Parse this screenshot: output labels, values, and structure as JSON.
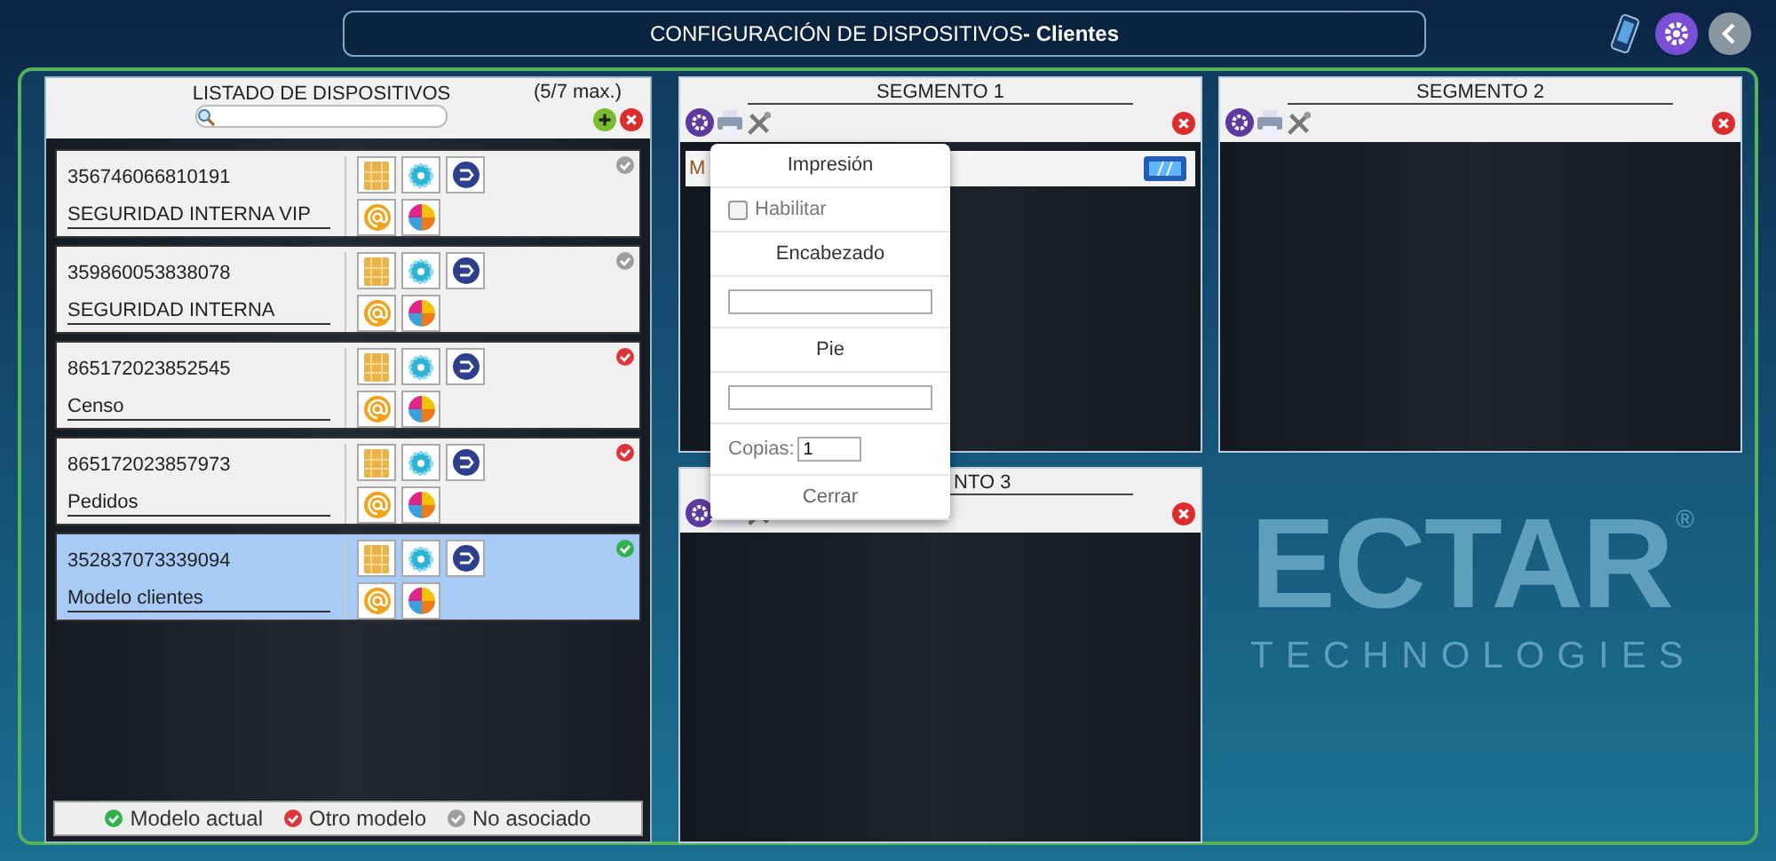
{
  "header": {
    "title": "CONFIGURACIÓN DE DISPOSITIVOS**- Clientes**"
  },
  "device_list": {
    "title": "LISTADO DE DISPOSITIVOS",
    "count": "(5/7 max.)",
    "devices": [
      {
        "number": "356746066810191",
        "name": "SEGURIDAD INTERNA VIP",
        "color": "#9e9e9e",
        "selected": false
      },
      {
        "number": "359860053838078",
        "name": "SEGURIDAD INTERNA",
        "color": "#9e9e9e",
        "selected": false
      },
      {
        "number": "865172023852545",
        "name": "Censo",
        "color": "#e0343c",
        "selected": false
      },
      {
        "number": "865172023857973",
        "name": "Pedidos",
        "color": "#e0343c",
        "selected": false
      },
      {
        "number": "352837073339094",
        "name": "Modelo clientes",
        "color": "#2fb34a",
        "selected": true
      }
    ],
    "legend": [
      {
        "label": "Modelo actual",
        "color": "#2fb34a"
      },
      {
        "label": "Otro modelo",
        "color": "#e0343c"
      },
      {
        "label": "No asociado",
        "color": "#9e9e9e"
      }
    ]
  },
  "segments": [
    {
      "title": "SEGMENTO 1",
      "partially_hidden": false,
      "rows": [
        {
          "label": "M"
        }
      ]
    },
    {
      "title": "SEGMENTO 2",
      "partially_hidden": false
    },
    {
      "title": "NTO 3",
      "partially_hidden": true
    }
  ],
  "print_popup": {
    "title": "Impresión",
    "enable": {
      "label": "Habilitar",
      "checked": false
    },
    "header_label": "Encabezado",
    "footer_label": "Pie",
    "copies": {
      "label": "Copias:",
      "value": "1"
    },
    "close": "Cerrar"
  },
  "background_logo": {
    "name": "ECTAR",
    "mark": "®",
    "tagline": "TECHNOLOGIES"
  }
}
